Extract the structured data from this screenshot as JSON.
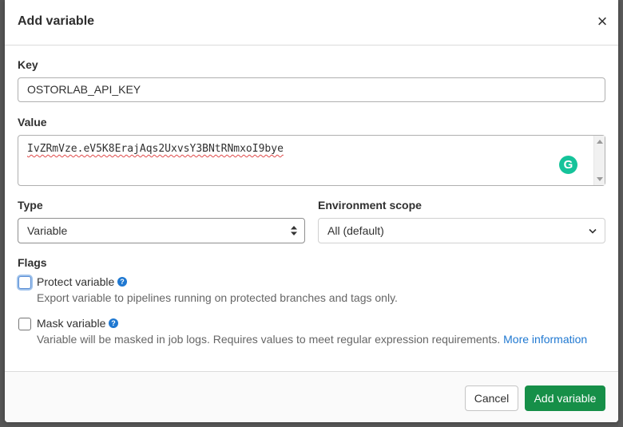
{
  "modal": {
    "title": "Add variable",
    "close_glyph": "×"
  },
  "form": {
    "key": {
      "label": "Key",
      "value": "OSTORLAB_API_KEY"
    },
    "value": {
      "label": "Value",
      "value": "IvZRmVze.eV5K8ErajAqs2UxvsY3BNtRNmxoI9bye",
      "extension_badge": "G"
    },
    "type": {
      "label": "Type",
      "selected": "Variable"
    },
    "environment_scope": {
      "label": "Environment scope",
      "selected": "All (default)"
    },
    "flags": {
      "label": "Flags",
      "protect": {
        "label": "Protect variable",
        "checked": false,
        "help": "Export variable to pipelines running on protected branches and tags only."
      },
      "mask": {
        "label": "Mask variable",
        "checked": false,
        "help": "Variable will be masked in job logs. Requires values to meet regular expression requirements.",
        "link_text": "More information"
      },
      "help_glyph": "?"
    }
  },
  "footer": {
    "cancel_label": "Cancel",
    "submit_label": "Add variable"
  },
  "colors": {
    "primary_button": "#168f48",
    "link": "#1f78d1",
    "help_icon": "#1f78d1",
    "grammarly": "#15c39a"
  },
  "icons": {
    "close": "close-icon",
    "type_select": "select-updown-icon",
    "env_select": "chevron-down-icon",
    "help": "question-circle-icon",
    "grammarly": "grammarly-icon"
  }
}
